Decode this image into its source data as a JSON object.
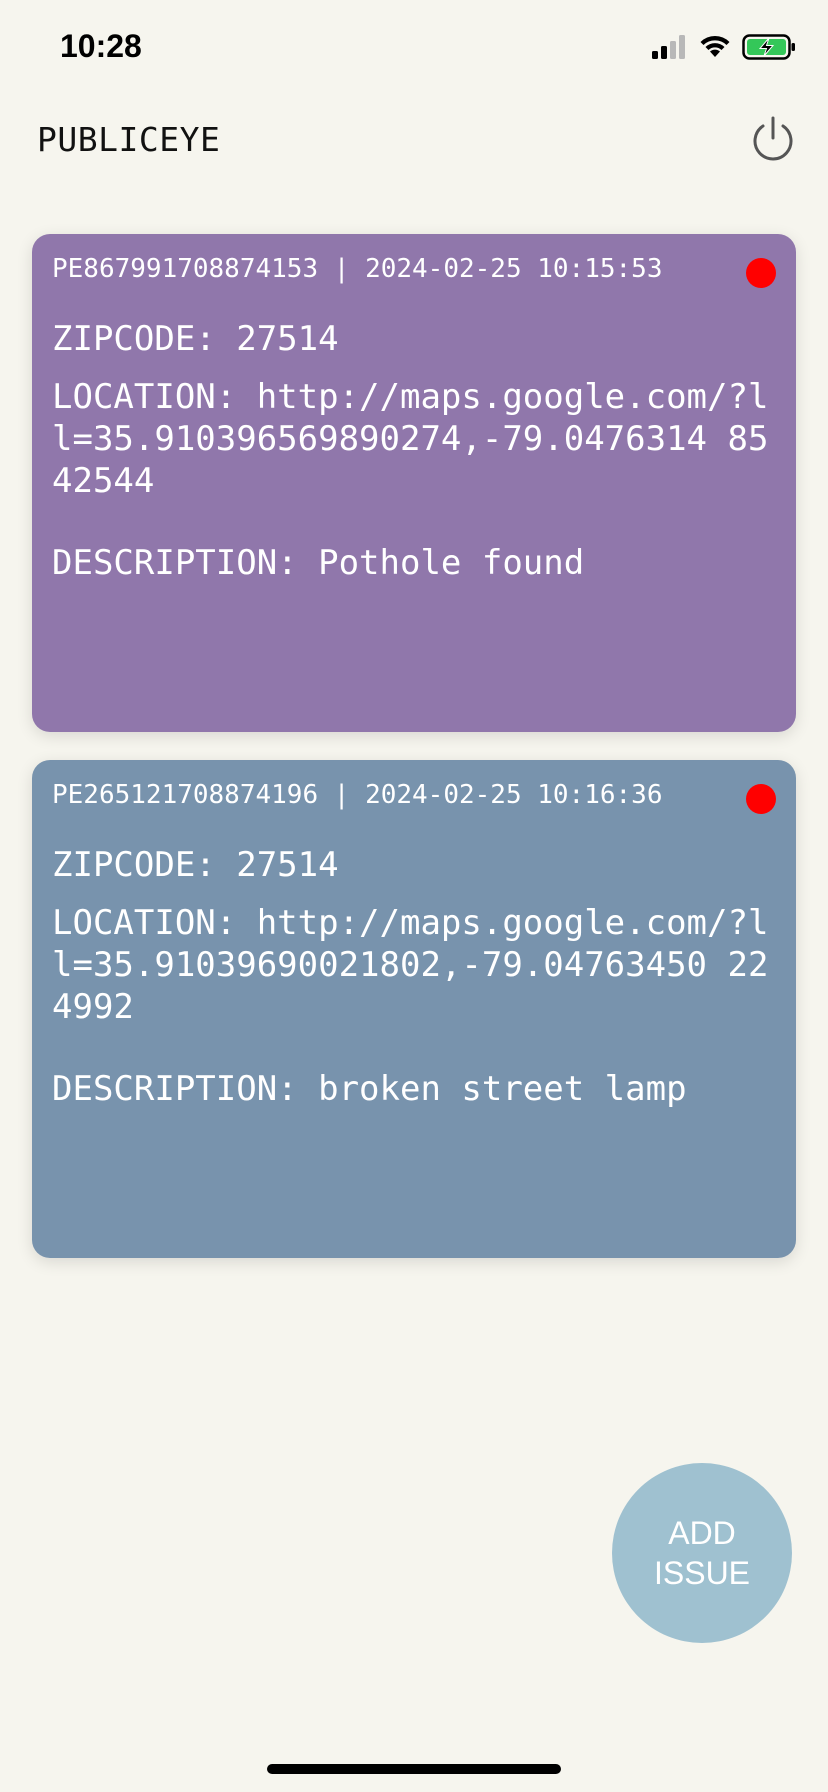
{
  "status_bar": {
    "time": "10:28"
  },
  "header": {
    "title": "PUBLICEYE",
    "power_icon": "power-icon"
  },
  "issues": [
    {
      "header": "PE867991708874153 | 2024-02-25 10:15:53",
      "zipcode": "ZIPCODE: 27514",
      "location": "LOCATION: http://maps.google.com/?ll=35.910396569890274,-79.0476314 8542544",
      "description": "DESCRIPTION: Pothole found",
      "card_color": "#9077ab",
      "status_color": "#ff0000"
    },
    {
      "header": "PE265121708874196 | 2024-02-25 10:16:36",
      "zipcode": "ZIPCODE: 27514",
      "location": "LOCATION: http://maps.google.com/?ll=35.91039690021802,-79.04763450 224992",
      "description": "DESCRIPTION: broken street lamp",
      "card_color": "#7893ad",
      "status_color": "#ff0000"
    }
  ],
  "add_button": {
    "label": "ADD ISSUE",
    "color": "#9fc1d0"
  }
}
